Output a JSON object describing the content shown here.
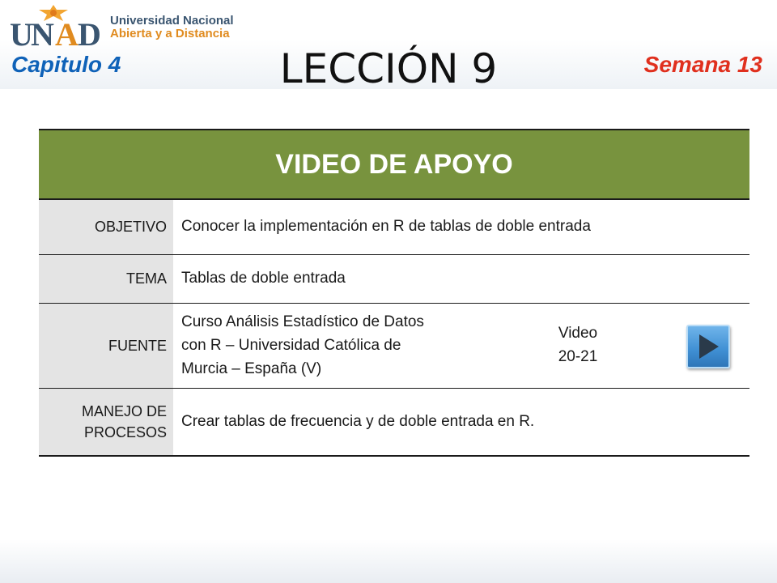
{
  "logo": {
    "mark_text": "UNAD",
    "line1": "Universidad Nacional",
    "line2": "Abierta y a Distancia"
  },
  "header": {
    "chapter": "Capitulo 4",
    "title": "LECCIÓN 9",
    "week": "Semana 13"
  },
  "table": {
    "title": "VIDEO DE APOYO",
    "rows": [
      {
        "label": "OBJETIVO",
        "value": "Conocer la implementación en R de tablas de doble entrada"
      },
      {
        "label": "TEMA",
        "value": "Tablas de doble entrada"
      },
      {
        "label": "FUENTE",
        "value": "Curso Análisis Estadístico de Datos con R – Universidad Católica de Murcia – España (V)"
      },
      {
        "label_line1": "MANEJO DE",
        "label_line2": "PROCESOS",
        "value": "Crear tablas de frecuencia y de doble entrada en R."
      }
    ],
    "source_lines": [
      "Curso Análisis Estadístico de Datos",
      "con R – Universidad Católica de",
      "Murcia – España (V)"
    ],
    "video_label": "Video",
    "video_range": "20-21",
    "play_icon": "play-icon"
  },
  "colors": {
    "header_green": "#78933e",
    "chapter_blue": "#0f62b8",
    "week_red": "#e0301e",
    "logo_blue": "#3a5570",
    "logo_orange": "#e08b1f"
  }
}
